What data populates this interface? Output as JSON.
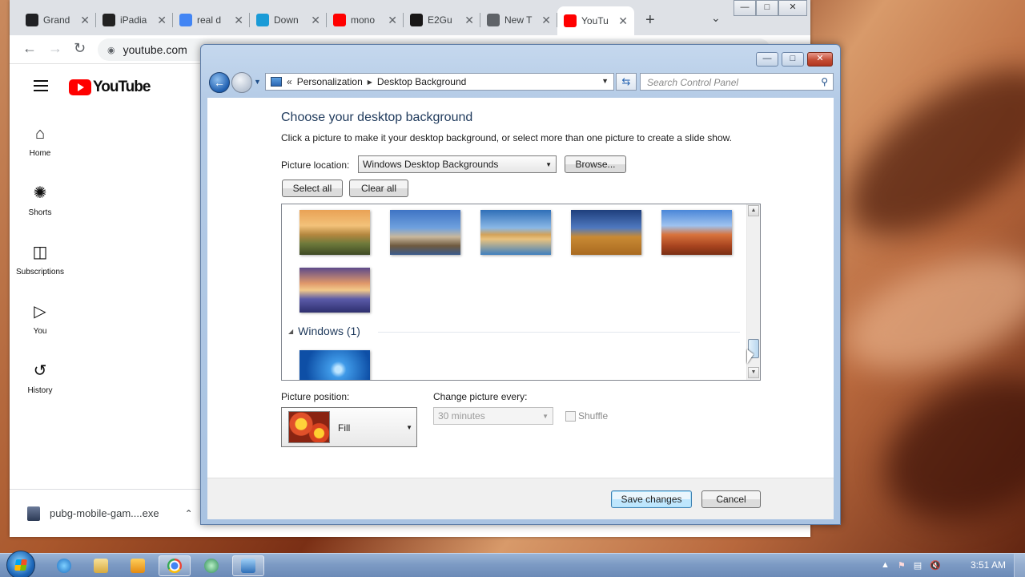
{
  "browser": {
    "tabs": [
      {
        "title": "Grand",
        "favicon_color": "#202124"
      },
      {
        "title": "iPadia",
        "favicon_color": "#222222"
      },
      {
        "title": "real d",
        "favicon_color": "#4285f4"
      },
      {
        "title": "Down",
        "favicon_color": "#1a9bd7"
      },
      {
        "title": "mono",
        "favicon_color": "#ff0000"
      },
      {
        "title": "E2Gu",
        "favicon_color": "#181717"
      },
      {
        "title": "New T",
        "favicon_color": "#5f6368"
      },
      {
        "title": "YouTu",
        "favicon_color": "#ff0000",
        "active": true
      }
    ],
    "url": "youtube.com"
  },
  "youtube": {
    "logo_text": "YouTube",
    "guide": [
      {
        "label": "Home",
        "icon": "home-icon"
      },
      {
        "label": "Shorts",
        "icon": "shorts-icon"
      },
      {
        "label": "Subscriptions",
        "icon": "subscriptions-icon"
      },
      {
        "label": "You",
        "icon": "you-icon"
      },
      {
        "label": "History",
        "icon": "history-icon"
      }
    ],
    "download_file": "pubg-mobile-gam....exe"
  },
  "control_panel": {
    "breadcrumb": [
      "Personalization",
      "Desktop Background"
    ],
    "search_placeholder": "Search Control Panel",
    "heading": "Choose your desktop background",
    "instructions": "Click a picture to make it your desktop background, or select more than one picture to create a slide show.",
    "picture_location_label": "Picture location:",
    "picture_location_value": "Windows Desktop Backgrounds",
    "browse_label": "Browse...",
    "select_all_label": "Select all",
    "clear_all_label": "Clear all",
    "group_label": "Windows (1)",
    "picture_position_label": "Picture position:",
    "picture_position_value": "Fill",
    "change_every_label": "Change picture every:",
    "change_every_value": "30 minutes",
    "shuffle_label": "Shuffle",
    "save_label": "Save changes",
    "cancel_label": "Cancel"
  },
  "taskbar": {
    "time": "3:51 AM"
  }
}
